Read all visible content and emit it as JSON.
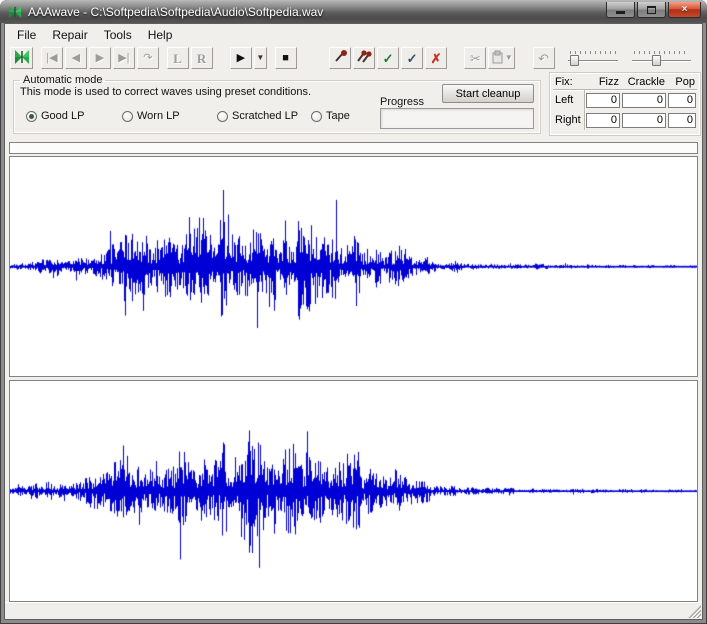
{
  "window": {
    "title": "AAAwave - C:\\Softpedia\\Softpedia\\Audio\\Softpedia.wav",
    "close_glyph": "×"
  },
  "menu": {
    "items": [
      "File",
      "Repair",
      "Tools",
      "Help"
    ]
  },
  "toolbar": {
    "nav": {
      "first": "|◀",
      "prev": "◀",
      "next": "▶",
      "last": "▶|",
      "replay": "↷"
    },
    "channel": {
      "left": "L",
      "right": "R"
    },
    "transport": {
      "play": "▶",
      "dropdown": "▼",
      "stop": "■"
    },
    "marks": {
      "check": "✓",
      "check2": "✓",
      "delete": "✗"
    },
    "edit": {
      "cut": "✂",
      "paste_dropdown": "▼",
      "undo": "↶"
    }
  },
  "automatic_mode": {
    "legend": "Automatic mode",
    "description": "This mode is used to correct waves using preset conditions.",
    "radios": [
      {
        "label": "Good LP",
        "selected": true
      },
      {
        "label": "Worn LP",
        "selected": false
      },
      {
        "label": "Scratched LP",
        "selected": false
      },
      {
        "label": "Tape",
        "selected": false
      }
    ],
    "progress_label": "Progress",
    "start_button": "Start cleanup"
  },
  "fix": {
    "title": "Fix:",
    "columns": [
      "Fizz",
      "Crackle",
      "Pop"
    ],
    "rows": [
      {
        "label": "Left",
        "values": [
          "0",
          "0",
          "0"
        ]
      },
      {
        "label": "Right",
        "values": [
          "0",
          "0",
          "0"
        ]
      }
    ]
  },
  "waveform": {
    "color": "#0000d6",
    "envelope": [
      [
        0,
        4
      ],
      [
        0.03,
        6
      ],
      [
        0.055,
        10
      ],
      [
        0.08,
        8
      ],
      [
        0.11,
        13
      ],
      [
        0.14,
        20
      ],
      [
        0.17,
        34
      ],
      [
        0.2,
        30
      ],
      [
        0.23,
        33
      ],
      [
        0.26,
        42
      ],
      [
        0.29,
        50
      ],
      [
        0.32,
        45
      ],
      [
        0.35,
        54
      ],
      [
        0.38,
        43
      ],
      [
        0.41,
        45
      ],
      [
        0.44,
        48
      ],
      [
        0.47,
        36
      ],
      [
        0.5,
        38
      ],
      [
        0.53,
        28
      ],
      [
        0.56,
        20
      ],
      [
        0.59,
        13
      ],
      [
        0.62,
        8
      ],
      [
        0.65,
        5.5
      ],
      [
        0.69,
        3.5
      ],
      [
        0.74,
        2.8
      ],
      [
        0.8,
        2.2
      ],
      [
        0.88,
        1.8
      ],
      [
        1,
        1.4
      ]
    ],
    "channels": [
      {
        "name": "left",
        "seed": 1337
      },
      {
        "name": "right",
        "seed": 90210
      }
    ]
  }
}
